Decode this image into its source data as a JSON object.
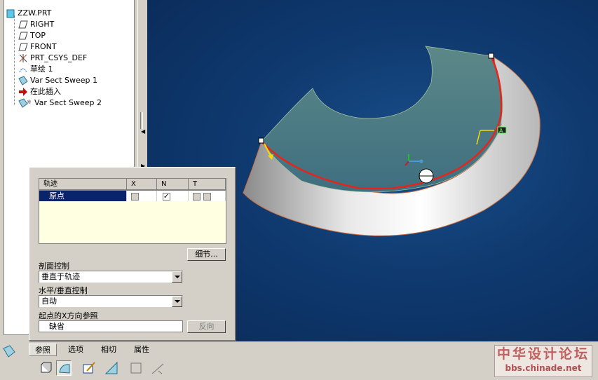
{
  "model_tree": {
    "items": [
      {
        "label": "ZZW.PRT",
        "icon": "part-icon"
      },
      {
        "label": "RIGHT",
        "icon": "datum-plane-icon"
      },
      {
        "label": "TOP",
        "icon": "datum-plane-icon"
      },
      {
        "label": "FRONT",
        "icon": "datum-plane-icon"
      },
      {
        "label": "PRT_CSYS_DEF",
        "icon": "csys-icon"
      },
      {
        "label": "草绘 1",
        "icon": "sketch-icon"
      },
      {
        "label": "Var Sect Sweep 1",
        "icon": "sweep-icon"
      },
      {
        "label": "在此插入",
        "icon": "insert-here-arrow-icon"
      },
      {
        "label": "Var Sect Sweep 2",
        "icon": "sweep-new-icon"
      }
    ]
  },
  "refs_panel": {
    "table": {
      "headers": [
        "轨迹",
        "X",
        "N",
        "T"
      ],
      "rows": [
        {
          "name": "原点",
          "x": false,
          "n": true,
          "t": false
        }
      ]
    },
    "details_button": "细节...",
    "section_control_label": "剖面控制",
    "section_control_value": "垂直于轨迹",
    "hv_control_label": "水平/垂直控制",
    "hv_control_value": "自动",
    "xdir_ref_label": "起点的X方向参照",
    "xdir_ref_value": "缺省",
    "flip_button": "反向"
  },
  "dashboard": {
    "tabs": [
      "参照",
      "选项",
      "相切",
      "属性"
    ],
    "active_tab": "参照",
    "tools": [
      "solid-icon",
      "surface-icon",
      "sketch-edit-icon",
      "thicken-icon",
      "remove-material-icon",
      "trim-icon"
    ]
  },
  "watermark": {
    "line1": "中华设计论坛",
    "line2": "bbs.chinade.net"
  },
  "colors": {
    "background": "#d4d0c8",
    "viewport": "#0f3a70",
    "selection": "#0a246a",
    "trajectory": "#e8241a",
    "surface": "#5a8a8a"
  }
}
